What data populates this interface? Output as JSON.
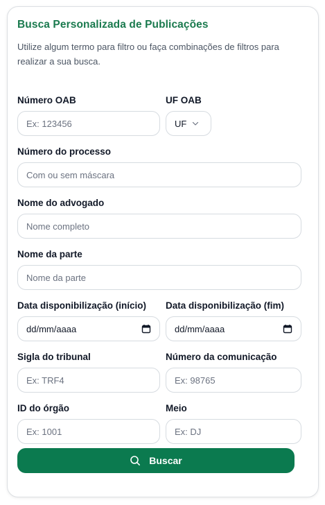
{
  "form": {
    "title": "Busca Personalizada de Publicações",
    "description": "Utilize algum termo para filtro ou faça combinações de filtros para realizar a sua busca.",
    "fields": {
      "oab_number": {
        "label": "Número OAB",
        "placeholder": "Ex: 123456"
      },
      "uf_oab": {
        "label": "UF OAB",
        "value": "UF"
      },
      "process_number": {
        "label": "Número do processo",
        "placeholder": "Com ou sem máscara"
      },
      "lawyer_name": {
        "label": "Nome do advogado",
        "placeholder": "Nome completo"
      },
      "party_name": {
        "label": "Nome da parte",
        "placeholder": "Nome da parte"
      },
      "date_start": {
        "label": "Data disponibilização (início)",
        "value": "dd/mm/aaaa"
      },
      "date_end": {
        "label": "Data disponibilização (fim)",
        "value": "dd/mm/aaaa"
      },
      "court_acronym": {
        "label": "Sigla do tribunal",
        "placeholder": "Ex: TRF4"
      },
      "communication_number": {
        "label": "Número da comunicação",
        "placeholder": "Ex: 98765"
      },
      "organ_id": {
        "label": "ID do órgão",
        "placeholder": "Ex: 1001"
      },
      "medium": {
        "label": "Meio",
        "placeholder": "Ex: DJ"
      }
    },
    "submit_label": "Buscar"
  },
  "colors": {
    "accent": "#1a7a4e",
    "button": "#0b7a4f",
    "border": "#d6dbe0"
  },
  "icons": {
    "submit": "search-icon",
    "date": "calendar-icon",
    "select": "chevron-down-icon"
  }
}
